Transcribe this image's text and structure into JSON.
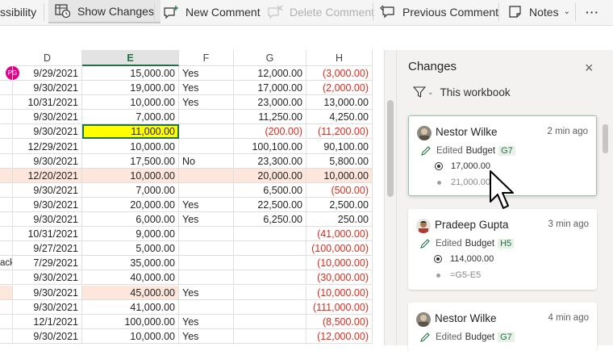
{
  "ribbon": {
    "accessibility_label": "ssibility",
    "show_changes_label": "Show Changes",
    "new_comment_label": "New Comment",
    "delete_comment_label": "Delete Comment",
    "previous_comment_label": "Previous Comment",
    "notes_label": "Notes",
    "more_label": "···"
  },
  "grid": {
    "columns": [
      "D",
      "E",
      "F",
      "G",
      "H"
    ],
    "selected_column": "E",
    "presence_badge": "PG",
    "rows": [
      {
        "a": "",
        "d": "9/29/2021",
        "e": "15,000.00",
        "f": "Yes",
        "g": "12,000.00",
        "h": "(3,000.00)"
      },
      {
        "a": "",
        "d": "9/30/2021",
        "e": "19,000.00",
        "f": "Yes",
        "g": "17,000.00",
        "h": "(2,000.00)"
      },
      {
        "a": "",
        "d": "10/31/2021",
        "e": "10,000.00",
        "f": "Yes",
        "g": "23,000.00",
        "h": "13,000.00"
      },
      {
        "a": "",
        "d": "9/30/2021",
        "e": "7,000.00",
        "f": "",
        "g": "11,250.00",
        "h": "4,250.00"
      },
      {
        "a": "",
        "d": "9/30/2021",
        "e": "11,000.00",
        "f": "",
        "g": "(200.00)",
        "h": "(11,200.00)"
      },
      {
        "a": "",
        "d": "12/29/2021",
        "e": "10,000.00",
        "f": "",
        "g": "100,100.00",
        "h": "90,100.00"
      },
      {
        "a": "",
        "d": "9/30/2021",
        "e": "17,500.00",
        "f": "No",
        "g": "23,300.00",
        "h": "5,800.00"
      },
      {
        "a": "",
        "d": "12/20/2021",
        "e": "10,000.00",
        "f": "",
        "g": "20,000.00",
        "h": "10,000.00"
      },
      {
        "a": "",
        "d": "9/30/2021",
        "e": "7,000.00",
        "f": "",
        "g": "6,500.00",
        "h": "(500.00)"
      },
      {
        "a": "",
        "d": "9/30/2021",
        "e": "20,000.00",
        "f": "Yes",
        "g": "22,500.00",
        "h": "2,500.00"
      },
      {
        "a": "",
        "d": "9/30/2021",
        "e": "6,000.00",
        "f": "Yes",
        "g": "6,250.00",
        "h": "250.00"
      },
      {
        "a": "",
        "d": "10/31/2021",
        "e": "9,000.00",
        "f": "",
        "g": "",
        "h": "(41,000.00)"
      },
      {
        "a": "",
        "d": "9/27/2021",
        "e": "5,000.00",
        "f": "",
        "g": "",
        "h": "(100,000.00)"
      },
      {
        "a": "ack",
        "d": "7/29/2021",
        "e": "35,000.00",
        "f": "",
        "g": "",
        "h": "(10,000.00)"
      },
      {
        "a": "",
        "d": "9/30/2021",
        "e": "40,000.00",
        "f": "",
        "g": "",
        "h": "(30,000.00)"
      },
      {
        "a": "",
        "d": "9/30/2021",
        "e": "45,000.00",
        "f": "Yes",
        "g": "",
        "h": "(10,000.00)"
      },
      {
        "a": "",
        "d": "9/30/2021",
        "e": "41,000.00",
        "f": "",
        "g": "",
        "h": "(111,000.00)"
      },
      {
        "a": "",
        "d": "12/1/2021",
        "e": "100,000.00",
        "f": "Yes",
        "g": "",
        "h": "(8,500.00)"
      },
      {
        "a": "",
        "d": "9/30/2021",
        "e": "10,000.00",
        "f": "Yes",
        "g": "",
        "h": "(12,000.00)"
      }
    ]
  },
  "changes_pane": {
    "title": "Changes",
    "close_label": "×",
    "filter_label": "This workbook",
    "cards": [
      {
        "author": "Nestor Wilke",
        "time": "2 min ago",
        "action": "Edited",
        "sheet": "Budget",
        "cell": "G7",
        "new_value": "17,000.00",
        "old_value": "21,000.00"
      },
      {
        "author": "Pradeep Gupta",
        "time": "3 min ago",
        "action": "Edited",
        "sheet": "Budget",
        "cell": "H5",
        "new_value": "114,000.00",
        "old_value": "=G5-E5"
      },
      {
        "author": "Nestor Wilke",
        "time": "4 min ago",
        "action": "Edited",
        "sheet": "Budget",
        "cell": "G7"
      }
    ]
  },
  "colors": {
    "accent_green": "#217346",
    "negative_red": "#e02b1c",
    "highlight_yellow": "#ffff00",
    "highlight_peach": "#fde7dc",
    "presence_pink": "#e3008c"
  }
}
